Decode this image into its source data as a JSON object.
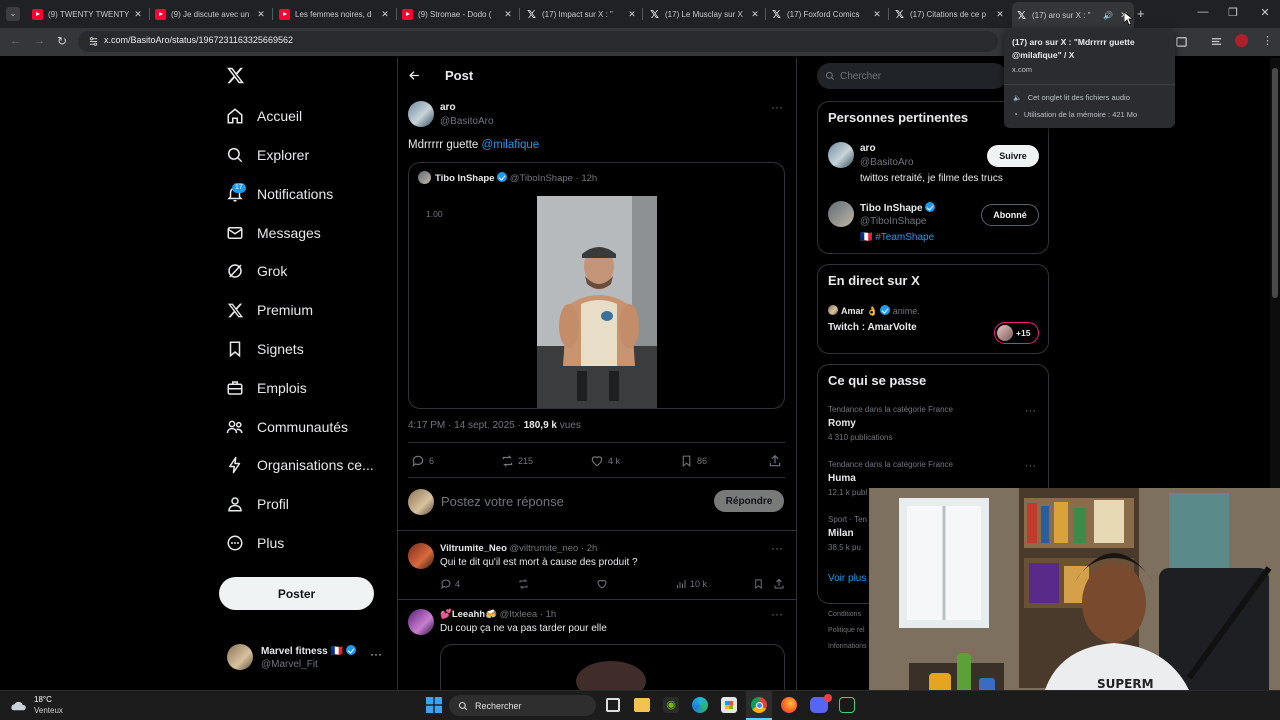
{
  "browser": {
    "tabs": [
      {
        "title": "(9) TWENTY TWENTY",
        "icon": "youtube-icon"
      },
      {
        "title": "(9) Je discute avec un",
        "icon": "youtube-icon"
      },
      {
        "title": "Les femmes noires, d",
        "icon": "youtube-icon"
      },
      {
        "title": "(9) Stromae - Dodo (",
        "icon": "youtube-icon"
      },
      {
        "title": "(17) Impact sur X : \"",
        "icon": "x-icon"
      },
      {
        "title": "(17) Le Musclay sur X",
        "icon": "x-icon"
      },
      {
        "title": "(17) Foxford Comics",
        "icon": "x-icon"
      },
      {
        "title": "(17) Citations de ce p",
        "icon": "x-icon"
      },
      {
        "title": "(17) aro sur X : \"",
        "icon": "x-icon"
      }
    ],
    "url": "x.com/BasitoAro/status/1967231163325669562",
    "tooltip": {
      "title": "(17) aro sur X : \"Mdrrrrr guette @milafique\" / X",
      "domain": "x.com",
      "audio": "Cet onglet lit des fichiers audio",
      "memory": "Utilisation de la mémoire : 421 Mo"
    }
  },
  "sidebar": {
    "items": [
      {
        "label": "Accueil",
        "icon": "home-icon"
      },
      {
        "label": "Explorer",
        "icon": "search-icon"
      },
      {
        "label": "Notifications",
        "icon": "bell-icon",
        "badge": "17"
      },
      {
        "label": "Messages",
        "icon": "mail-icon"
      },
      {
        "label": "Grok",
        "icon": "grok-icon"
      },
      {
        "label": "Premium",
        "icon": "x-icon"
      },
      {
        "label": "Signets",
        "icon": "bookmark-icon"
      },
      {
        "label": "Emplois",
        "icon": "briefcase-icon"
      },
      {
        "label": "Communautés",
        "icon": "people-icon"
      },
      {
        "label": "Organisations ce...",
        "icon": "lightning-icon"
      },
      {
        "label": "Profil",
        "icon": "person-icon"
      },
      {
        "label": "Plus",
        "icon": "more-circle-icon"
      }
    ],
    "post_button": "Poster",
    "account": {
      "name": "Marvel fitness 🇫🇷",
      "handle": "@Marvel_Fit"
    }
  },
  "main": {
    "header": "Post",
    "post": {
      "name": "aro",
      "handle": "@BasitoAro",
      "text": "Mdrrrrr guette ",
      "mention": "@milafique",
      "quote": {
        "name": "Tibo InShape",
        "handle": "@TiboInShape",
        "time": "· 12h",
        "overlay": "1.00"
      },
      "timestamp": "4:17 PM · 14 sept. 2025 · ",
      "views_count": "180,9 k",
      "views_label": " vues",
      "stats": {
        "replies": "6",
        "reposts": "215",
        "likes": "4 k",
        "bookmarks": "86"
      }
    },
    "reply_box": {
      "placeholder": "Postez votre réponse",
      "button": "Répondre"
    },
    "replies": [
      {
        "name": "Viltrumite_Neo",
        "handle": "@viltrumite_neo",
        "time": "· 2h",
        "text": "Qui te dit qu'il est mort à cause des produit ?",
        "replies": "4",
        "views": "10 k"
      },
      {
        "name": "💕Leeahh🍻",
        "handle": "@Itxleea",
        "time": "· 1h",
        "text": "Du coup ça ne va pas tarder pour elle"
      }
    ]
  },
  "right": {
    "search_placeholder": "Chercher",
    "relevant": {
      "title": "Personnes pertinentes",
      "people": [
        {
          "name": "aro",
          "handle": "@BasitoAro",
          "bio": "twittos retraité, je filme des trucs",
          "button": "Suivre"
        },
        {
          "name": "Tibo InShape",
          "handle": "@TiboInShape",
          "bio": "🇫🇷 #TeamShape",
          "button": "Abonné"
        }
      ]
    },
    "live": {
      "title": "En direct sur X",
      "host": "Amar 👌",
      "host_role": "anime.",
      "stream": "Twitch : AmarVolte",
      "count": "+15"
    },
    "trends": {
      "title": "Ce qui se passe",
      "items": [
        {
          "context": "Tendance dans la catégorie France",
          "name": "Romy",
          "count": "4 310 publications"
        },
        {
          "context": "Tendance dans la catégorie France",
          "name": "Huma",
          "count": "12,1 k publ"
        },
        {
          "context": "Sport · Ten",
          "name": "Milan",
          "count": "38,5 k pu"
        }
      ],
      "more": "Voir plus"
    },
    "footer": [
      "Conditions",
      "Politique rel",
      "Informations"
    ]
  },
  "taskbar": {
    "weather_temp": "18°C",
    "weather_desc": "Venteux",
    "search": "Rechercher"
  },
  "colors": {
    "accent": "#1d9bf0",
    "background": "#000000",
    "border": "#2f3336",
    "muted": "#71767b"
  }
}
